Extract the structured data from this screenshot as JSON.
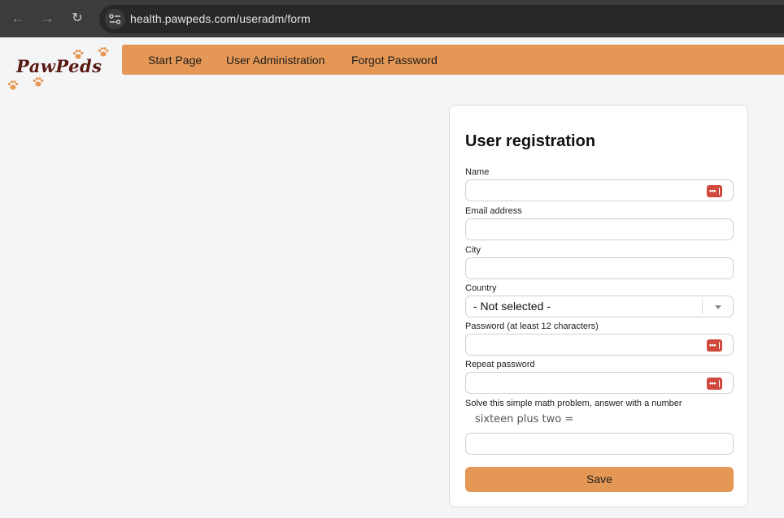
{
  "browser": {
    "url": "health.pawpeds.com/useradm/form",
    "icons": {
      "back": "arrow-left-icon",
      "forward": "arrow-right-icon",
      "reload": "reload-icon",
      "site_info": "tune-icon"
    }
  },
  "site": {
    "logo_text": "PawPeds",
    "brand_color": "#e59855",
    "logo_color": "#5a1a14"
  },
  "nav": {
    "items": [
      {
        "label": "Start Page"
      },
      {
        "label": "User Administration"
      },
      {
        "label": "Forgot Password"
      }
    ]
  },
  "form": {
    "title": "User registration",
    "fields": {
      "name": {
        "label": "Name",
        "value": "",
        "password_manager_icon": "password-key-icon"
      },
      "email": {
        "label": "Email address",
        "value": ""
      },
      "city": {
        "label": "City",
        "value": ""
      },
      "country": {
        "label": "Country",
        "selected": "- Not selected -"
      },
      "password": {
        "label": "Password (at least 12 characters)",
        "value": "",
        "password_manager_icon": "password-key-icon"
      },
      "repeat_password": {
        "label": "Repeat password",
        "value": "",
        "password_manager_icon": "password-key-icon"
      },
      "math": {
        "label": "Solve this simple math problem, answer with a number",
        "question": "sixteen plus two =",
        "value": ""
      }
    },
    "pw_icon_glyph": "•••",
    "save_label": "Save",
    "accent_color": "#cf4a3c"
  }
}
